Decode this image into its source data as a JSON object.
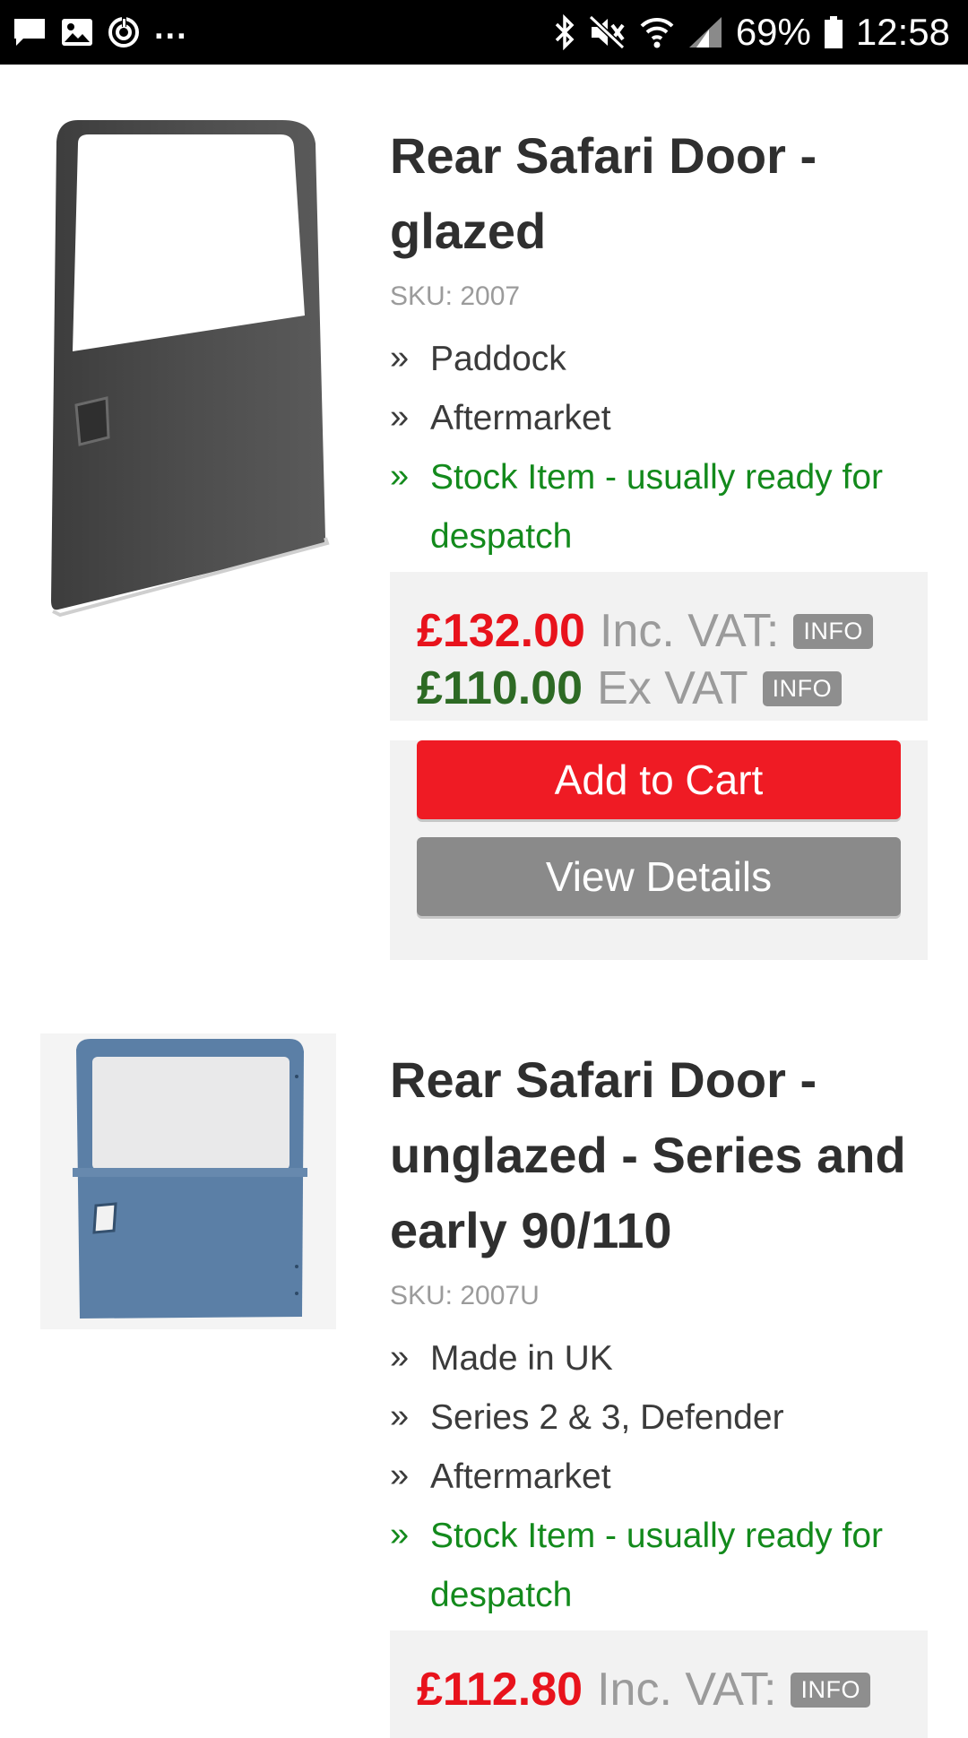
{
  "status_bar": {
    "battery": "69%",
    "time": "12:58",
    "more_indicator": "..."
  },
  "products": [
    {
      "title": "Rear Safari Door - glazed",
      "sku": "SKU: 2007",
      "image_alt": "Grey glazed rear safari door",
      "features": [
        "Paddock",
        "Aftermarket"
      ],
      "stock": "Stock Item - usually ready for despatch",
      "price_inc": "£132.00",
      "inc_label": "Inc. VAT:",
      "price_ex": "£110.00",
      "ex_label": "Ex VAT",
      "info_label": "INFO",
      "add_to_cart": "Add to Cart",
      "view_details": "View Details"
    },
    {
      "title": "Rear Safari Door - unglazed - Series and early 90/110",
      "sku": "SKU: 2007U",
      "image_alt": "Blue unglazed rear safari door",
      "features": [
        "Made in UK",
        "Series 2 & 3, Defender",
        "Aftermarket"
      ],
      "stock": "Stock Item - usually ready for despatch",
      "price_inc": "£112.80",
      "inc_label": "Inc. VAT:",
      "info_label": "INFO"
    }
  ],
  "colors": {
    "inc_price": "#e8131c",
    "ex_price": "#2d6a24",
    "stock_text": "#138a1c",
    "add_to_cart_bg": "#ef1b24",
    "view_details_bg": "#8a8a8a"
  }
}
